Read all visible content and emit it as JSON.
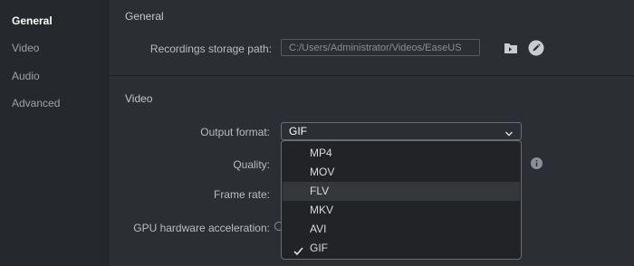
{
  "sidebar": {
    "items": [
      {
        "label": "General"
      },
      {
        "label": "Video"
      },
      {
        "label": "Audio"
      },
      {
        "label": "Advanced"
      }
    ]
  },
  "general": {
    "title": "General",
    "storage_label": "Recordings storage path:",
    "storage_path": "C:/Users/Administrator/Videos/EaseUS",
    "icons": [
      "folder-open-icon",
      "edit-pencil-icon"
    ]
  },
  "video": {
    "title": "Video",
    "output_format_label": "Output format:",
    "output_format_value": "GIF",
    "quality_label": "Quality:",
    "frame_rate_label": "Frame rate:",
    "gpu_label": "GPU hardware acceleration:",
    "format_options": [
      "MP4",
      "MOV",
      "FLV",
      "MKV",
      "AVI",
      "GIF"
    ]
  },
  "colors": {
    "background": "#2b2e33",
    "sidebar": "#25282c",
    "dropdown": "#212327",
    "hover": "#34373c"
  }
}
